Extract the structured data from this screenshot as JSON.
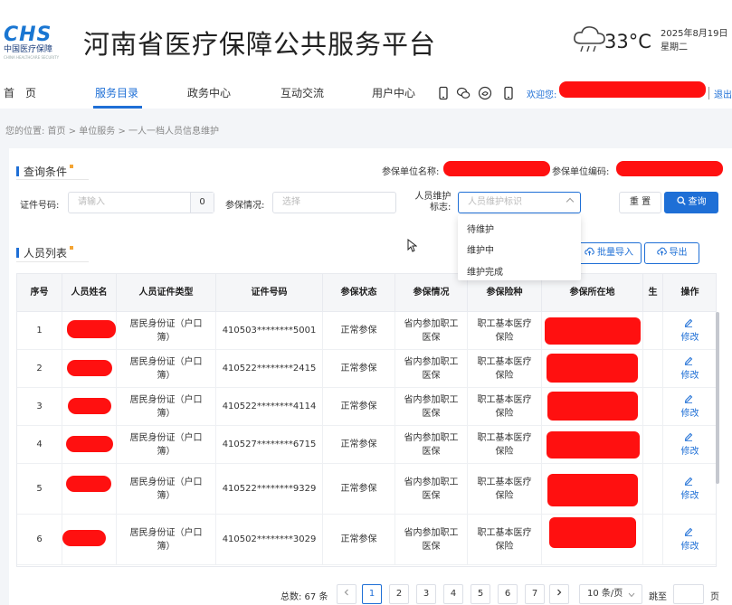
{
  "header": {
    "logo_text": "CHS",
    "logo_sub": "中国医疗保障",
    "logo_tiny": "CHINA HEALTHCARE SECURITY",
    "site_title": "河南省医疗保障公共服务平台",
    "temperature": "33°C",
    "date": "2025年8月19日",
    "weekday": "星期二"
  },
  "nav": {
    "items": [
      {
        "label": "首　页"
      },
      {
        "label": "服务目录",
        "active": true
      },
      {
        "label": "政务中心"
      },
      {
        "label": "互动交流"
      },
      {
        "label": "用户中心"
      }
    ],
    "welcome": "欢迎您:",
    "logout": "退出"
  },
  "breadcrumb": "您的位置:  首页  >  单位服务  >  一人一档人员信息维护",
  "query": {
    "title": "查询条件",
    "unit_name_label": "参保单位名称:",
    "unit_code_label": "参保单位编码:",
    "id_label": "证件号码:",
    "id_placeholder": "请输入",
    "id_count": "0",
    "status_label": "参保情况:",
    "status_placeholder": "选择",
    "maint_label_1": "人员维护",
    "maint_label_2": "标志:",
    "maint_placeholder": "人员维护标识",
    "reset": "重 置",
    "search": "查询",
    "dropdown": [
      "待维护",
      "维护中",
      "维护完成"
    ]
  },
  "list": {
    "title": "人员列表",
    "import": "批量导入",
    "export": "导出",
    "columns": [
      "序号",
      "人员姓名",
      "人员证件类型",
      "证件号码",
      "参保状态",
      "参保情况",
      "参保险种",
      "参保所在地",
      "生",
      "操作"
    ],
    "rows": [
      {
        "no": "1",
        "type_1": "居民身份证（户口",
        "type_2": "簿）",
        "id": "410503********5001",
        "status": "正常参保",
        "situation_1": "省内参加职工",
        "situation_2": "医保",
        "insurance_1": "职工基本医疗",
        "insurance_2": "保险",
        "action": "修改"
      },
      {
        "no": "2",
        "type_1": "居民身份证（户口",
        "type_2": "簿）",
        "id": "410522********2415",
        "status": "正常参保",
        "situation_1": "省内参加职工",
        "situation_2": "医保",
        "insurance_1": "职工基本医疗",
        "insurance_2": "保险",
        "action": "修改"
      },
      {
        "no": "3",
        "type_1": "居民身份证（户口",
        "type_2": "簿）",
        "id": "410522********4114",
        "status": "正常参保",
        "situation_1": "省内参加职工",
        "situation_2": "医保",
        "insurance_1": "职工基本医疗",
        "insurance_2": "保险",
        "action": "修改"
      },
      {
        "no": "4",
        "type_1": "居民身份证（户口",
        "type_2": "簿）",
        "id": "410527********6715",
        "status": "正常参保",
        "situation_1": "省内参加职工",
        "situation_2": "医保",
        "insurance_1": "职工基本医疗",
        "insurance_2": "保险",
        "action": "修改"
      },
      {
        "no": "5",
        "type_1": "居民身份证（户口",
        "type_2": "簿）",
        "id": "410522********9329",
        "status": "正常参保",
        "situation_1": "省内参加职工",
        "situation_2": "医保",
        "insurance_1": "职工基本医疗",
        "insurance_2": "保险",
        "action": "修改"
      },
      {
        "no": "6",
        "type_1": "居民身份证（户口",
        "type_2": "簿）",
        "id": "410502********3029",
        "status": "正常参保",
        "situation_1": "省内参加职工",
        "situation_2": "医保",
        "insurance_1": "职工基本医疗",
        "insurance_2": "保险",
        "action": "修改"
      }
    ]
  },
  "pagination": {
    "total": "总数:  67 条",
    "pages": [
      "1",
      "2",
      "3",
      "4",
      "5",
      "6",
      "7"
    ],
    "current": "1",
    "page_size": "10 条/页",
    "jump_label": "跳至",
    "page_unit": "页"
  },
  "colors": {
    "primary": "#1e6fd6",
    "redaction": "#ff1010",
    "accent_dot": "#f4a534"
  }
}
